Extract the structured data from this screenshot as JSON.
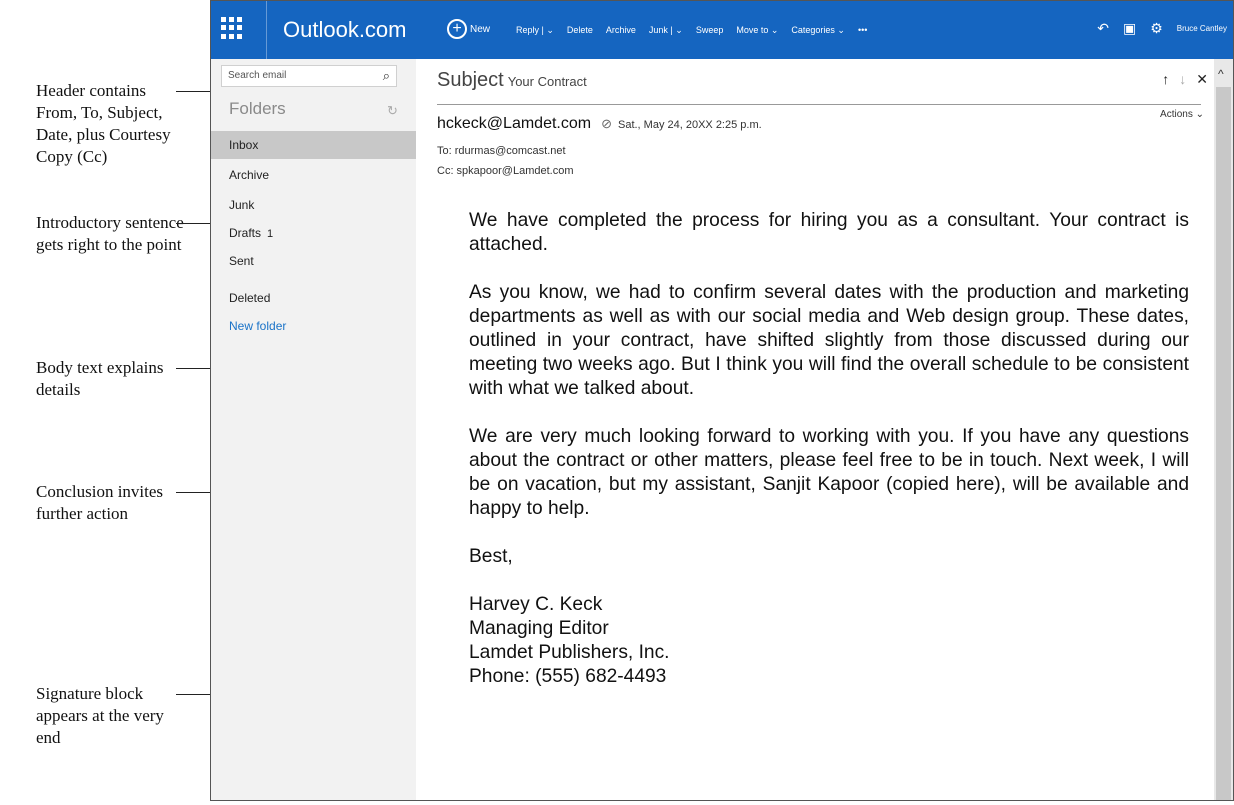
{
  "annotations": [
    {
      "text": "Header contains From, To, Subject, Date, plus Courtesy Copy (Cc)"
    },
    {
      "text": "Introductory sentence gets right to the point"
    },
    {
      "text": "Body text explains details"
    },
    {
      "text": "Conclusion invites further action"
    },
    {
      "text": "Signature block appears at the very end"
    }
  ],
  "topbar": {
    "brand": "Outlook.com",
    "new_label": "New",
    "commands": [
      "Reply | ⌄",
      "Delete",
      "Archive",
      "Junk | ⌄",
      "Sweep",
      "Move to ⌄",
      "Categories ⌄",
      "•••"
    ],
    "user": "Bruce Cantley",
    "accent": "#1565c0"
  },
  "sidebar": {
    "search_placeholder": "Search email",
    "folders_heading": "Folders",
    "items": [
      {
        "label": "Inbox",
        "count": ""
      },
      {
        "label": "Archive",
        "count": ""
      },
      {
        "label": "Junk",
        "count": ""
      },
      {
        "label": "Drafts",
        "count": "1"
      },
      {
        "label": "Sent",
        "count": ""
      },
      {
        "label": "Deleted",
        "count": ""
      }
    ],
    "new_folder": "New folder"
  },
  "message": {
    "subject_label": "Subject",
    "subject": "Your Contract",
    "actions": "Actions ⌄",
    "from": "hckeck@Lamdet.com",
    "date": "Sat., May 24, 20XX 2:25 p.m.",
    "to": "To: rdurmas@comcast.net",
    "cc": "Cc: spkapoor@Lamdet.com",
    "paragraphs": [
      "We have completed the process for hiring you as a consultant. Your contract is attached.",
      "As you know, we had to confirm several dates with the production and marketing departments as well as with our social media and Web design group. These dates, outlined in your contract, have shifted slightly from those discussed during our meeting two weeks ago. But I think you will find the overall schedule to be consistent with what we talked about.",
      "We are very much looking forward to working with you. If you have any questions about the contract or other matters, please feel free to be in touch. Next week, I will be on vacation, but my assistant, Sanjit Kapoor (copied here), will be available and happy to help."
    ],
    "closing": "Best,",
    "signature": {
      "name": "Harvey C. Keck",
      "title": "Managing Editor",
      "company": "Lamdet Publishers, Inc.",
      "phone": "Phone: (555) 682-4493"
    }
  }
}
